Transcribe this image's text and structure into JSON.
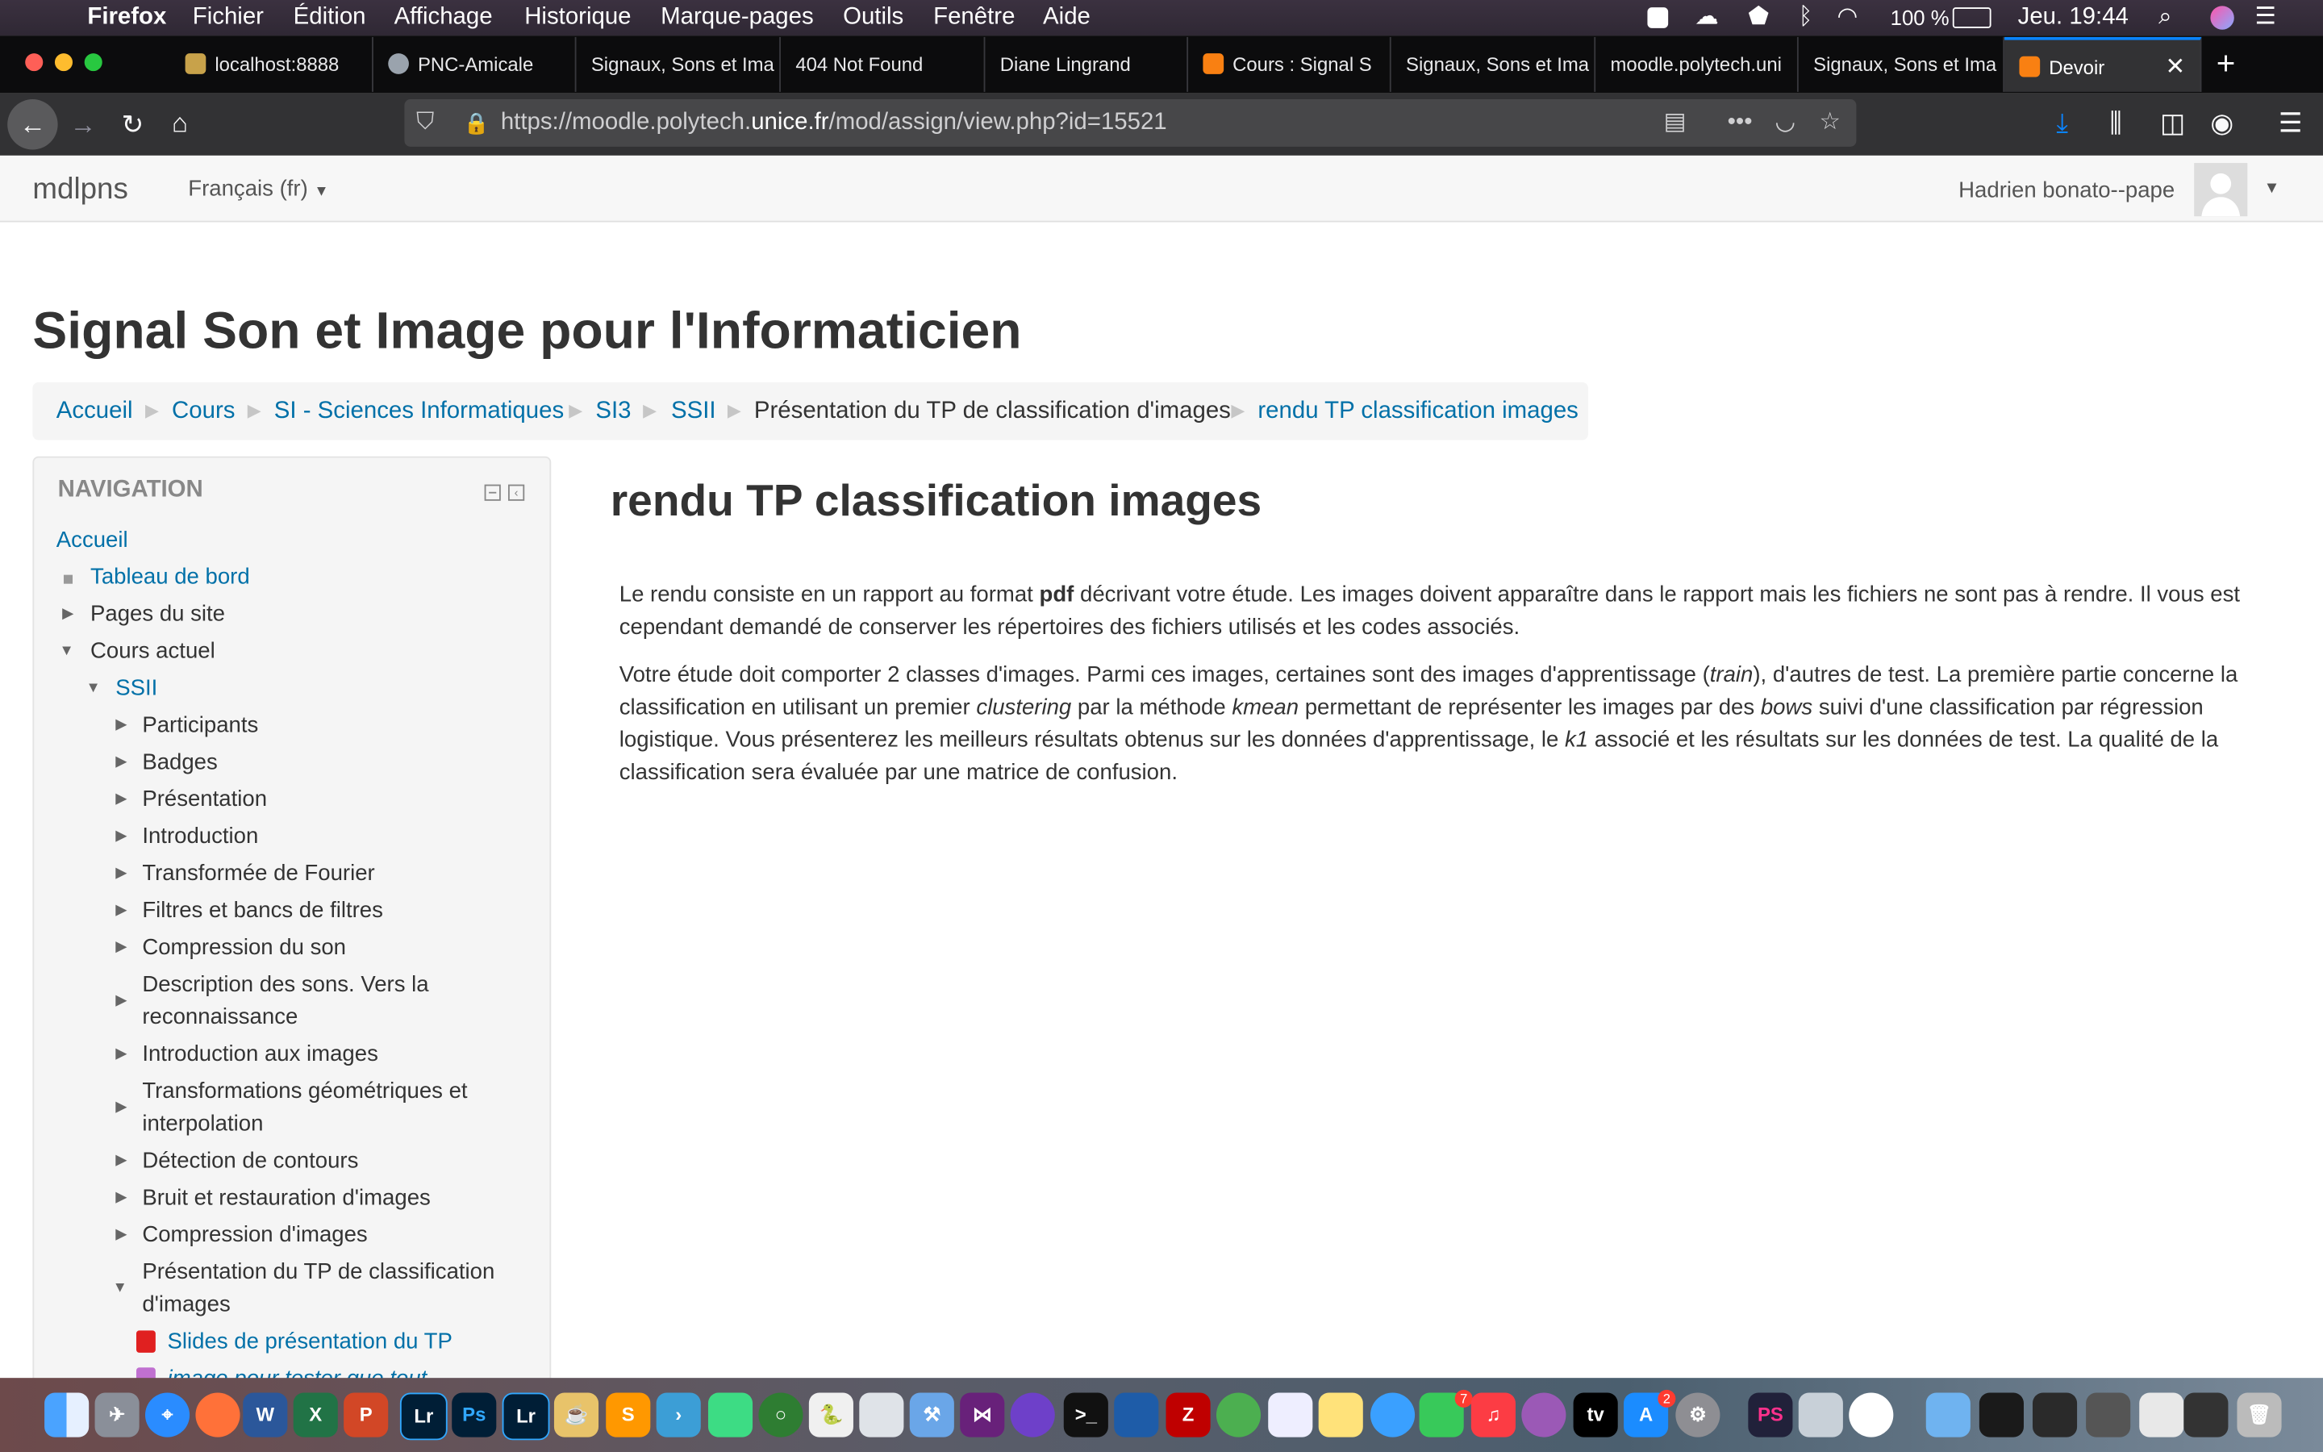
{
  "menubar": {
    "app": "Firefox",
    "items": [
      "Fichier",
      "Édition",
      "Affichage",
      "Historique",
      "Marque-pages",
      "Outils",
      "Fenêtre",
      "Aide"
    ],
    "battery": "100 %",
    "clock": "Jeu. 19:44"
  },
  "tabs": [
    {
      "label": "localhost:8888",
      "color": "#c8a24a"
    },
    {
      "label": "PNC-Amicale",
      "color": "#9aa3ad"
    },
    {
      "label": "Signaux, Sons et Ima",
      "color": ""
    },
    {
      "label": "404 Not Found",
      "color": ""
    },
    {
      "label": "Diane Lingrand",
      "color": ""
    },
    {
      "label": "Cours : Signal S",
      "color": "#f98012"
    },
    {
      "label": "Signaux, Sons et Ima",
      "color": ""
    },
    {
      "label": "moodle.polytech.uni",
      "color": ""
    },
    {
      "label": "Signaux, Sons et Ima",
      "color": ""
    },
    {
      "label": "Devoir",
      "color": "#f98012"
    }
  ],
  "urlbar": {
    "prefix": "https://moodle.polytech.",
    "domain": "unice.fr",
    "path": "/mod/assign/view.php?id=15521"
  },
  "header": {
    "brand": "mdlpns",
    "language": "Français (fr)",
    "user": "Hadrien bonato--pape"
  },
  "page_title": "Signal Son et Image pour l'Informaticien",
  "breadcrumb": [
    {
      "label": "Accueil",
      "link": true
    },
    {
      "label": "Cours",
      "link": true
    },
    {
      "label": "SI - Sciences Informatiques",
      "link": true
    },
    {
      "label": "SI3",
      "link": true
    },
    {
      "label": "SSII",
      "link": true
    },
    {
      "label": "Présentation du TP de classification d'images",
      "link": false
    },
    {
      "label": "rendu TP classification images",
      "link": true
    }
  ],
  "navigation": {
    "title": "NAVIGATION",
    "home": "Accueil",
    "dashboard": "Tableau de bord",
    "site_pages": "Pages du site",
    "current_course": "Cours actuel",
    "course": "SSII",
    "sections": [
      "Participants",
      "Badges",
      "Présentation",
      "Introduction",
      "Transformée de Fourier",
      "Filtres et bancs de filtres",
      "Compression du son",
      "Description des sons. Vers la reconnaissance",
      "Introduction aux images",
      "Transformations géométriques et interpolation",
      "Détection de contours",
      "Bruit et restauration d'images",
      "Compression d'images",
      "Présentation du TP de classification d'images"
    ],
    "resources": [
      "Slides de présentation du TP",
      "image pour tester que tout"
    ]
  },
  "main": {
    "title": "rendu TP classification images",
    "p1": [
      "Le rendu consiste en un rapport au format ",
      "pdf",
      " décrivant votre étude. Les images doivent apparaître dans le rapport mais les fichiers ne sont pas à rendre. Il vous est cependant demandé de conserver les répertoires des fichiers utilisés et les codes associés."
    ],
    "p2": [
      "Votre étude doit comporter 2 classes d'images. Parmi ces images, certaines sont des images d'apprentissage (",
      "train",
      "), d'autres de test. La première partie concerne la classification en utilisant un premier ",
      "clustering",
      " par la méthode ",
      "kmean",
      " permettant de représenter les images par des ",
      "bows",
      " suivi d'une classification par régression logistique.  Vous présenterez les meilleurs résultats obtenus sur les données d'apprentissage, le ",
      "k1",
      " associé et les résultats sur les données de test. La qualité de la classification sera évaluée par une matrice de confusion."
    ]
  },
  "dock": {
    "badges": [
      "7",
      "2"
    ]
  }
}
